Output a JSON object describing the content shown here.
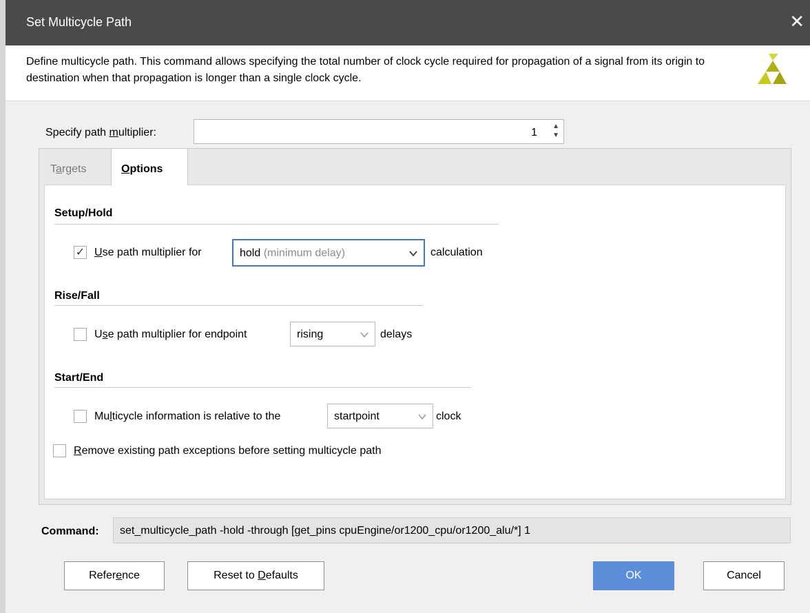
{
  "window": {
    "title": "Set Multicycle Path",
    "close_glyph": "✕"
  },
  "header": {
    "description": "Define multicycle path. This command allows specifying the total number of clock cycle required for propagation of a signal from its origin to destination when that propagation is longer than a single clock cycle.",
    "logo_icon": "xilinx-logo-icon"
  },
  "multiplier": {
    "label_pre": "Specify path ",
    "label_mnemonic": "m",
    "label_post": "ultiplier:",
    "value": "1"
  },
  "tabs": [
    {
      "pre": "T",
      "mnemonic": "a",
      "post": "rgets",
      "selected": false
    },
    {
      "pre": "",
      "mnemonic": "O",
      "post": "ptions",
      "selected": true
    }
  ],
  "setup_hold": {
    "heading": "Setup/Hold",
    "checked": true,
    "label_pre": "",
    "label_mnemonic": "U",
    "label_post": "se path multiplier for",
    "select_value": "hold",
    "select_hint": "(minimum delay)",
    "suffix": "calculation"
  },
  "rise_fall": {
    "heading": "Rise/Fall",
    "checked": false,
    "label_pre": "U",
    "label_mnemonic": "s",
    "label_post": "e path multiplier for endpoint",
    "select_value": "rising",
    "suffix": "delays"
  },
  "start_end": {
    "heading": "Start/End",
    "checked": false,
    "label_pre": "Mu",
    "label_mnemonic": "l",
    "label_post": "ticycle information is relative to the",
    "select_value": "startpoint",
    "suffix": "clock"
  },
  "remove_exceptions": {
    "checked": false,
    "label_pre": "",
    "label_mnemonic": "R",
    "label_post": "emove existing path exceptions before setting multicycle path"
  },
  "command": {
    "label": "Command:",
    "text": "set_multicycle_path -hold -through [get_pins cpuEngine/or1200_cpu/or1200_alu/*] 1"
  },
  "buttons": {
    "reference": {
      "pre": "Refer",
      "mnemonic": "e",
      "post": "nce"
    },
    "reset": {
      "pre": "Reset to ",
      "mnemonic": "D",
      "post": "efaults"
    },
    "ok": "OK",
    "cancel": "Cancel"
  },
  "colors": {
    "titlebar": "#4a4a4a",
    "ok_button": "#5b8dd8",
    "focus_border": "#3c78c8",
    "logo": "#c8c81e"
  }
}
